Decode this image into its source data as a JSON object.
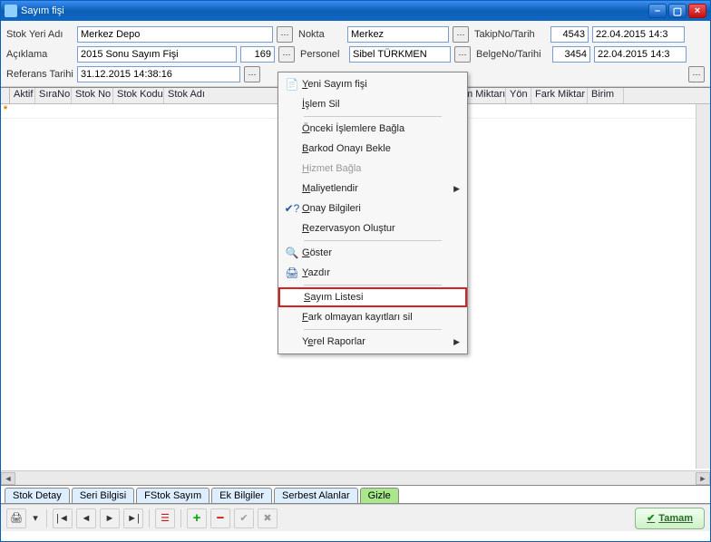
{
  "window": {
    "title": "Sayım fişi"
  },
  "form": {
    "stokYeriAdi_label": "Stok Yeri Adı",
    "stokYeriAdi": "Merkez Depo",
    "aciklama_label": "Açıklama",
    "aciklama": "2015 Sonu Sayım Fişi",
    "aciklama_no": "169",
    "referansTarihi_label": "Referans Tarihi",
    "referansTarihi": "31.12.2015 14:38:16",
    "nokta_label": "Nokta",
    "nokta": "Merkez",
    "personel_label": "Personel",
    "personel": "Sibel TÜRKMEN",
    "takipNoTarih_label": "TakipNo/Tarih",
    "takipNo": "4543",
    "takipTarih": "22.04.2015 14:3",
    "belgeNoTarihi_label": "BelgeNo/Tarihi",
    "belgeNo": "3454",
    "belgeTarih": "22.04.2015 14:3"
  },
  "columns": [
    "Aktif",
    "SıraNo",
    "Stok No",
    "Stok Kodu",
    "Stok Adı",
    "Sayım Miktarı",
    "Yön",
    "Fark Miktar",
    "Birim"
  ],
  "tabs": [
    "Stok Detay",
    "Seri Bilgisi",
    "FStok Sayım",
    "Ek Bilgiler",
    "Serbest Alanlar",
    "Gizle"
  ],
  "toolbar": {
    "tamam": "Tamam"
  },
  "menu": {
    "yeni": "Yeni Sayım fişi",
    "islemSil": "İşlem Sil",
    "onceki": "Önceki İşlemlere Bağla",
    "barkod": "Barkod Onayı Bekle",
    "hizmet": "Hizmet Bağla",
    "maliyet": "Maliyetlendir",
    "onayBilgileri": "Onay Bilgileri",
    "rezervasyon": "Rezervasyon Oluştur",
    "goster": "Göster",
    "yazdir": "Yazdır",
    "sayimListesi": "Sayım Listesi",
    "farkSil": "Fark olmayan kayıtları sil",
    "yerel": "Yerel Raporlar"
  }
}
